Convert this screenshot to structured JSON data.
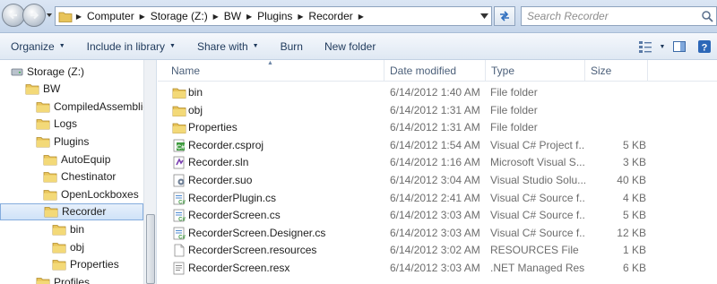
{
  "address_bar": {
    "crumbs": [
      "Computer",
      "Storage (Z:)",
      "BW",
      "Plugins",
      "Recorder"
    ],
    "search_placeholder": "Search Recorder"
  },
  "toolbar": {
    "organize": "Organize",
    "include_in_library": "Include in library",
    "share_with": "Share with",
    "burn": "Burn",
    "new_folder": "New folder"
  },
  "nav_tree": [
    {
      "label": "Storage (Z:)",
      "icon": "drive-icon"
    },
    {
      "label": "BW",
      "icon": "folder-icon"
    },
    {
      "label": "CompiledAssemblies",
      "icon": "folder-icon"
    },
    {
      "label": "Logs",
      "icon": "folder-icon"
    },
    {
      "label": "Plugins",
      "icon": "folder-icon"
    },
    {
      "label": "AutoEquip",
      "icon": "folder-icon"
    },
    {
      "label": "Chestinator",
      "icon": "folder-icon"
    },
    {
      "label": "OpenLockboxes",
      "icon": "folder-icon"
    },
    {
      "label": "Recorder",
      "icon": "folder-icon",
      "selected": true
    },
    {
      "label": "bin",
      "icon": "folder-icon"
    },
    {
      "label": "obj",
      "icon": "folder-icon"
    },
    {
      "label": "Properties",
      "icon": "folder-icon"
    },
    {
      "label": "Profiles",
      "icon": "folder-icon"
    }
  ],
  "columns": {
    "name": "Name",
    "date_modified": "Date modified",
    "type": "Type",
    "size": "Size"
  },
  "files": [
    {
      "name": "bin",
      "date": "6/14/2012 1:40 AM",
      "type": "File folder",
      "size": "",
      "icon": "folder-icon"
    },
    {
      "name": "obj",
      "date": "6/14/2012 1:31 AM",
      "type": "File folder",
      "size": "",
      "icon": "folder-icon"
    },
    {
      "name": "Properties",
      "date": "6/14/2012 1:31 AM",
      "type": "File folder",
      "size": "",
      "icon": "folder-icon"
    },
    {
      "name": "Recorder.csproj",
      "date": "6/14/2012 1:54 AM",
      "type": "Visual C# Project f...",
      "size": "5 KB",
      "icon": "csproj-icon"
    },
    {
      "name": "Recorder.sln",
      "date": "6/14/2012 1:16 AM",
      "type": "Microsoft Visual S...",
      "size": "3 KB",
      "icon": "sln-icon"
    },
    {
      "name": "Recorder.suo",
      "date": "6/14/2012 3:04 AM",
      "type": "Visual Studio Solu...",
      "size": "40 KB",
      "icon": "suo-icon"
    },
    {
      "name": "RecorderPlugin.cs",
      "date": "6/14/2012 2:41 AM",
      "type": "Visual C# Source f...",
      "size": "4 KB",
      "icon": "cs-file-icon"
    },
    {
      "name": "RecorderScreen.cs",
      "date": "6/14/2012 3:03 AM",
      "type": "Visual C# Source f...",
      "size": "5 KB",
      "icon": "cs-file-icon"
    },
    {
      "name": "RecorderScreen.Designer.cs",
      "date": "6/14/2012 3:03 AM",
      "type": "Visual C# Source f...",
      "size": "12 KB",
      "icon": "cs-file-icon"
    },
    {
      "name": "RecorderScreen.resources",
      "date": "6/14/2012 3:02 AM",
      "type": "RESOURCES File",
      "size": "1 KB",
      "icon": "blank-file-icon"
    },
    {
      "name": "RecorderScreen.resx",
      "date": "6/14/2012 3:03 AM",
      "type": ".NET Managed Res...",
      "size": "6 KB",
      "icon": "resx-icon"
    }
  ],
  "colors": {
    "folder": "#e8c45a",
    "selection": "#cfe2f8",
    "command_text": "#1e395b"
  }
}
